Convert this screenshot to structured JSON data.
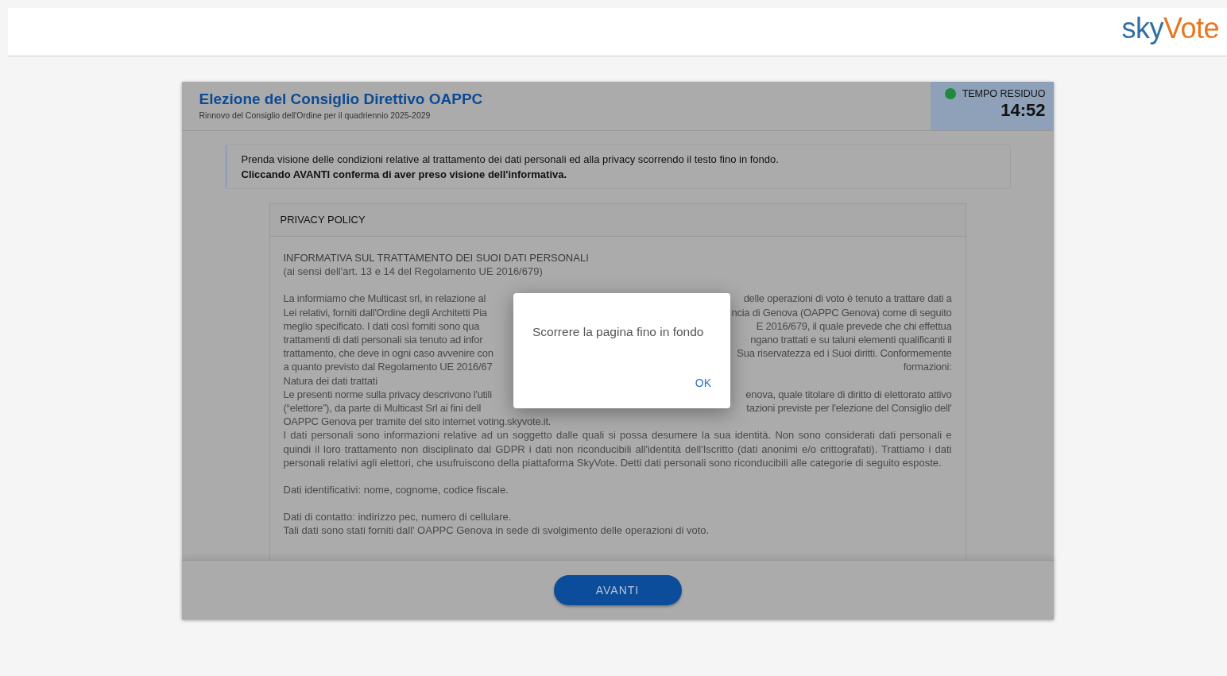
{
  "logo": {
    "part_1": "sky",
    "part_2": "Vote"
  },
  "header": {
    "title": "Elezione del Consiglio Direttivo OAPPC",
    "subtitle": "Rinnovo del Consiglio dell'Ordine per il quadriennio 2025-2029"
  },
  "timer": {
    "label": "TEMPO RESIDUO",
    "value": "14:52"
  },
  "notice": {
    "line_1": "Prenda visione delle condizioni relative al trattamento dei dati personali ed alla privacy scorrendo il testo fino in fondo.",
    "line_2": "Cliccando AVANTI conferma di aver preso visione dell'informativa."
  },
  "policy": {
    "heading": "PRIVACY POLICY",
    "doc_title": "INFORMATIVA SUL TRATTAMENTO DEI SUOI DATI PERSONALI",
    "doc_subtitle": "(ai sensi dell'art. 13 e 14 del Regolamento UE 2016/679)",
    "covered_lines": [
      {
        "left": "La informiamo che Multicast srl, in relazione al",
        "right": "delle operazioni di voto è tenuto a trattare dati a"
      },
      {
        "left": "Lei relativi, forniti dall'Ordine degli Architetti Pia",
        "right": "ncia di Genova (OAPPC Genova) come di seguito"
      },
      {
        "left": "meglio specificato. I dati così forniti sono qua",
        "right": "E 2016/679, il quale prevede che chi effettua"
      },
      {
        "left": "trattamenti di dati personali sia tenuto ad infor",
        "right": "ngano trattati e su taluni elementi qualificanti il"
      },
      {
        "left": "trattamento, che deve in ogni caso avvenire con",
        "right": "Sua riservatezza ed i Suoi diritti. Conformemente"
      },
      {
        "left": "a quanto previsto dal Regolamento UE 2016/67",
        "right": "formazioni:"
      },
      {
        "left": "Natura dei dati trattati"
      },
      {
        "left": "Le presenti norme sulla privacy descrivono l'utili",
        "right": "enova, quale titolare di diritto di elettorato attivo"
      },
      {
        "left": "(“elettore”), da parte di Multicast Srl ai fini dell",
        "right": "tazioni previste per l'elezione del Consiglio dell'"
      },
      {
        "left": "OAPPC Genova per tramite del sito internet voting.skyvote.it."
      }
    ],
    "paragraphs": [
      {
        "lines": [
          "I dati personali sono informazioni relative ad un soggetto dalle quali si possa desumere la sua identità. Non sono considerati dati personali e quindi il loro trattamento non disciplinato dal GDPR i dati non riconducibili all'identità dell'Iscritto (dati anonimi e/o crittografati). Trattiamo i dati personali relativi agli elettori, che usufruiscono della piattaforma SkyVote. Detti dati personali sono riconducibili alle categorie di seguito esposte."
        ]
      },
      {
        "lines": [
          "Dati identificativi: nome, cognome, codice fiscale."
        ]
      },
      {
        "lines": [
          "Dati di contatto: indirizzo pec, numero di cellulare.",
          "Tali dati sono stati forniti dall’ OAPPC Genova in sede di svolgimento delle operazioni di voto."
        ]
      }
    ]
  },
  "next_button": "AVANTI",
  "dialog": {
    "message": "Scorrere la pagina fino in fondo",
    "ok_button": "OK"
  }
}
